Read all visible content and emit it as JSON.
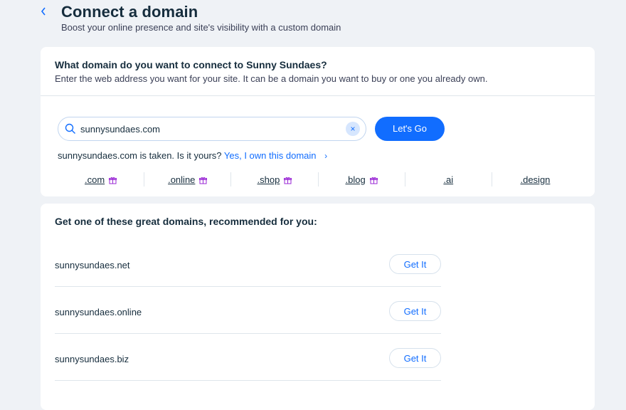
{
  "header": {
    "title": "Connect a domain",
    "subtitle": "Boost your online presence and site's visibility with a custom domain"
  },
  "search_card": {
    "heading": "What domain do you want to connect to Sunny Sundaes?",
    "description": "Enter the web address you want for your site. It can be a domain you want to buy or one you already own.",
    "input_value": "sunnysundaes.com",
    "clear_symbol": "×",
    "go_label": "Let's Go",
    "taken_text": "sunnysundaes.com is taken. Is it yours?",
    "own_link": "Yes, I own this domain",
    "own_chevron": "›",
    "tlds": [
      {
        "label": ".com",
        "gift": true
      },
      {
        "label": ".online",
        "gift": true
      },
      {
        "label": ".shop",
        "gift": true
      },
      {
        "label": ".blog",
        "gift": true
      },
      {
        "label": ".ai",
        "gift": false
      },
      {
        "label": ".design",
        "gift": false
      }
    ]
  },
  "recommendations": {
    "heading": "Get one of these great domains, recommended for you:",
    "get_label": "Get It",
    "items": [
      {
        "name": "sunnysundaes.net"
      },
      {
        "name": "sunnysundaes.online"
      },
      {
        "name": "sunnysundaes.biz"
      }
    ]
  },
  "colors": {
    "accent": "#116dff",
    "gift": "#9a27d5",
    "background": "#eff2f6"
  }
}
